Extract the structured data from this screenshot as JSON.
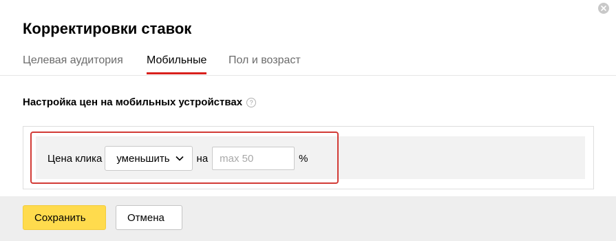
{
  "dialog": {
    "title": "Корректировки ставок",
    "close_icon": "close-icon"
  },
  "tabs": [
    {
      "label": "Целевая аудитория",
      "active": false
    },
    {
      "label": "Мобильные",
      "active": true
    },
    {
      "label": "Пол и возраст",
      "active": false
    }
  ],
  "section": {
    "title": "Настройка цен на мобильных устройствах",
    "help_icon": "question-icon",
    "help_glyph": "?"
  },
  "bid": {
    "label": "Цена клика",
    "action_value": "уменьшить",
    "connector": "на",
    "input_placeholder": "max 50",
    "unit": "%"
  },
  "footer": {
    "save_label": "Сохранить",
    "cancel_label": "Отмена"
  },
  "colors": {
    "accent": "#ffdb4d",
    "active_tab_underline": "#d8201c",
    "highlight": "#d23a35"
  }
}
